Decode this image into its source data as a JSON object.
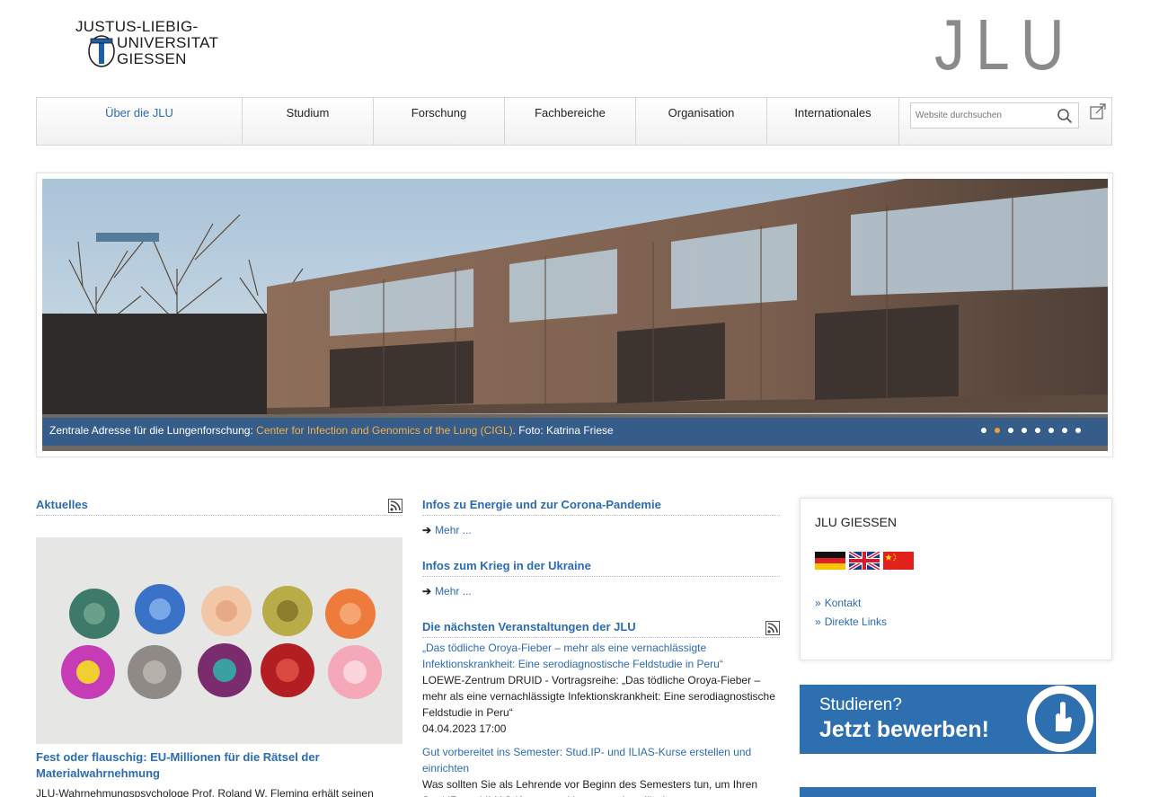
{
  "header": {
    "logo_left_lines": [
      "JUSTUS-LIEBIG-",
      "UNIVERSITAT",
      "GIESSEN"
    ],
    "logo_right": "JLU"
  },
  "nav": {
    "items": [
      {
        "label": "Über die JLU",
        "active": true
      },
      {
        "label": "Studium"
      },
      {
        "label": "Forschung"
      },
      {
        "label": "Fachbereiche"
      },
      {
        "label": "Organisation"
      },
      {
        "label": "Internationales"
      }
    ],
    "search_placeholder": "Website durchsuchen"
  },
  "slider": {
    "caption_prefix": "Zentrale Adresse für die Lungenforschung: ",
    "caption_link": "Center for Infection and Genomics of the Lung (CIGL)",
    "caption_suffix": ". Foto: Katrina Friese",
    "slide_count": 8,
    "active_index": 1
  },
  "aktuelles": {
    "heading": "Aktuelles",
    "news_title": "Fest oder flauschig: EU-Millionen für die Rätsel der Materialwahrnehmung",
    "news_text": "JLU-Wahrnehmungspsychologe Prof. Roland W. Fleming erhält seinen"
  },
  "middle": {
    "energie_heading": "Infos zu Energie und zur Corona-Pandemie",
    "energie_more": "Mehr ...",
    "ukraine_heading": "Infos zum Krieg in der Ukraine",
    "ukraine_more": "Mehr ...",
    "events_heading": "Die nächsten Veranstaltungen der JLU",
    "events": [
      {
        "title": "„Das tödliche Oroya-Fieber – mehr als eine vernachlässigte Infektionskrankheit: Eine serodiagnostische Feldstudie in Peru“",
        "desc": "LOEWE-Zentrum DRUID - Vortragsreihe: „Das tödliche Oroya-Fieber – mehr als eine vernachlässigte Infektionskrankheit: Eine serodiagnostische Feldstudie in Peru“",
        "date": "04.04.2023 17:00"
      },
      {
        "title": "Gut vorbereitet ins Semester: Stud.IP- und ILIAS-Kurse erstellen und einrichten",
        "desc": "Was sollten Sie als Lehrende vor Beginn des Semesters tun, um Ihren Stud.IP- und ILIAS-Kurse startklar zu machen für den"
      }
    ]
  },
  "right": {
    "box_title": "JLU GIESSEN",
    "links": [
      "Kontakt",
      "Direkte Links"
    ],
    "banner_line1": "Studieren?",
    "banner_line2": "Jetzt bewerben!"
  },
  "colors": {
    "link_blue": "#2b6bb2",
    "banner_blue": "#2e6fb0",
    "dot_active": "#f0a030"
  }
}
